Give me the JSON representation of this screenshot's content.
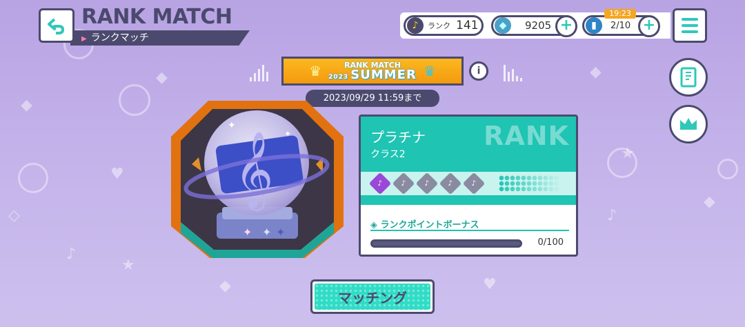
{
  "header": {
    "title_en": "RANK MATCH",
    "title_jp": "ランクマッチ",
    "back_icon": "back-arrow-icon"
  },
  "status": {
    "rank_label": "ランク",
    "rank_value": "141",
    "gems": "9205",
    "energy": "2/10",
    "energy_timer": "19:23",
    "plus": "+"
  },
  "season": {
    "line1": "RANK MATCH",
    "line2": "SUMMER",
    "year": "2023",
    "info": "i",
    "deadline": "2023/09/29 11:59まで"
  },
  "rank_card": {
    "name": "プラチナ",
    "class": "クラス2",
    "watermark": "RANK",
    "steps_total": 5,
    "steps_achieved": 1,
    "bonus_title": "ランクポイントボーナス",
    "bonus_progress": 0,
    "bonus_text": "0/100"
  },
  "buttons": {
    "matching": "マッチング"
  },
  "colors": {
    "accent": "#1fc4b3",
    "outline": "#4b4a6e",
    "banner": "#f5a623",
    "achieved": "#9a48d8"
  }
}
